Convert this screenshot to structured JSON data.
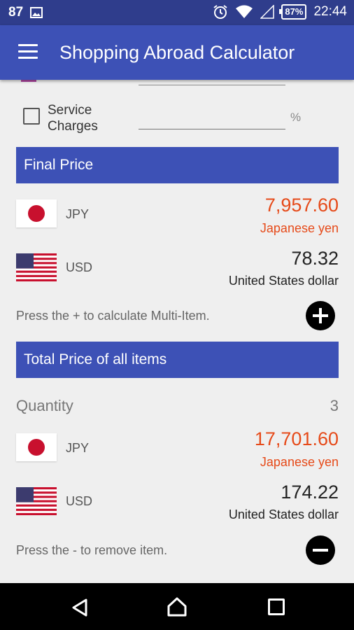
{
  "status_bar": {
    "notification_count": "87",
    "battery": "87%",
    "time": "22:44",
    "icons": [
      "image-icon",
      "alarm-icon",
      "wifi-icon",
      "signal-icon",
      "battery-icon"
    ]
  },
  "app_bar": {
    "title": "Shopping Abroad Calculator",
    "menu_icon": "hamburger-menu-icon"
  },
  "service_charges": {
    "label_line1": "Service",
    "label_line2": "Charges",
    "value": "",
    "unit": "%",
    "checked": false
  },
  "final_price": {
    "header": "Final Price",
    "rows": [
      {
        "flag": "japan-flag-icon",
        "code": "JPY",
        "amount": "7,957.60",
        "name": "Japanese yen"
      },
      {
        "flag": "us-flag-icon",
        "code": "USD",
        "amount": "78.32",
        "name": "United States dollar"
      }
    ],
    "hint": "Press the + to calculate Multi-Item.",
    "add_icon": "plus-circle-icon"
  },
  "total_price": {
    "header": "Total Price of all items",
    "quantity_label": "Quantity",
    "quantity_value": "3",
    "rows": [
      {
        "flag": "japan-flag-icon",
        "code": "JPY",
        "amount": "17,701.60",
        "name": "Japanese yen"
      },
      {
        "flag": "us-flag-icon",
        "code": "USD",
        "amount": "174.22",
        "name": "United States dollar"
      }
    ],
    "hint": "Press the - to remove item.",
    "remove_icon": "minus-circle-icon"
  },
  "colors": {
    "primary": "#3d51b6",
    "status_bar": "#2f3d8c",
    "accent_red": "#e64a19"
  },
  "nav_bar": {
    "icons": [
      "back-icon",
      "home-icon",
      "recents-icon"
    ]
  }
}
